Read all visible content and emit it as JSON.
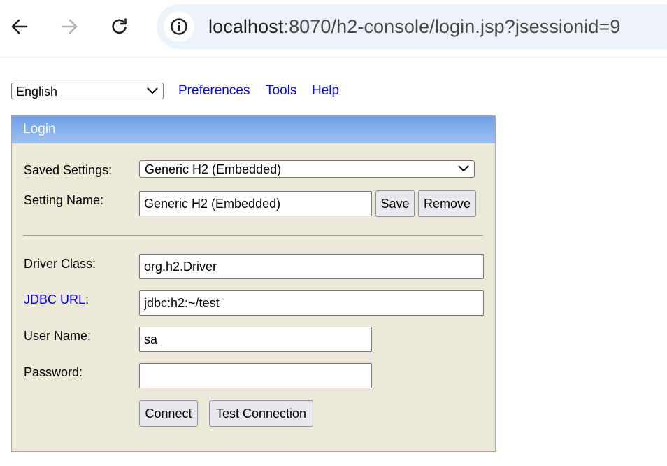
{
  "browser": {
    "url_host": "localhost",
    "url_rest": ":8070/h2-console/login.jsp?jsessionid=9",
    "icons": {
      "back": "arrow-left-icon",
      "forward": "arrow-right-icon",
      "reload": "reload-icon",
      "site_info": "info-icon"
    }
  },
  "topbar": {
    "language": "English",
    "links": {
      "preferences": "Preferences",
      "tools": "Tools",
      "help": "Help"
    }
  },
  "login": {
    "title": "Login",
    "saved_settings_label": "Saved Settings:",
    "saved_settings_value": "Generic H2 (Embedded)",
    "setting_name_label": "Setting Name:",
    "setting_name_value": "Generic H2 (Embedded)",
    "save_label": "Save",
    "remove_label": "Remove",
    "driver_class_label": "Driver Class:",
    "driver_class_value": "org.h2.Driver",
    "jdbc_url_link": "JDBC URL",
    "jdbc_url_colon": ":",
    "jdbc_url_value": "jdbc:h2:~/test",
    "user_name_label": "User Name:",
    "user_name_value": "sa",
    "password_label": "Password:",
    "password_value": "",
    "connect_label": "Connect",
    "test_connection_label": "Test Connection"
  },
  "colors": {
    "header_gradient_top": "#6e9fe6",
    "header_gradient_bottom": "#9ec0f2",
    "panel_bg": "#ece9d8",
    "link": "#0000ee",
    "omnibox_bg": "#edf1f9"
  }
}
